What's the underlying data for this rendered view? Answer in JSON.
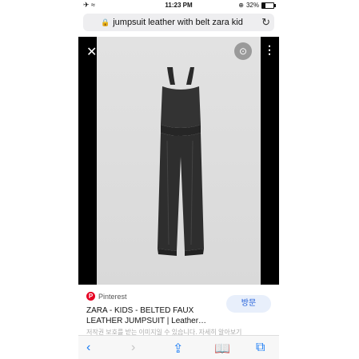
{
  "status_bar": {
    "time": "11:23 PM",
    "battery": "32%"
  },
  "browser": {
    "url": "jumpsuit leather with belt zara kid"
  },
  "pin": {
    "source": "Pinterest",
    "title": "ZARA - KIDS - BELTED FAUX LEATHER JUMPSUIT | Leather…",
    "visit_label": "방문",
    "notice": "저작권 보호를 받는 이미지일 수 있습니다.  자세히 알아보기"
  },
  "colors": {
    "accent": "#1a7cf5",
    "pinterest": "#e60023",
    "viewer_bg": "#000000"
  }
}
